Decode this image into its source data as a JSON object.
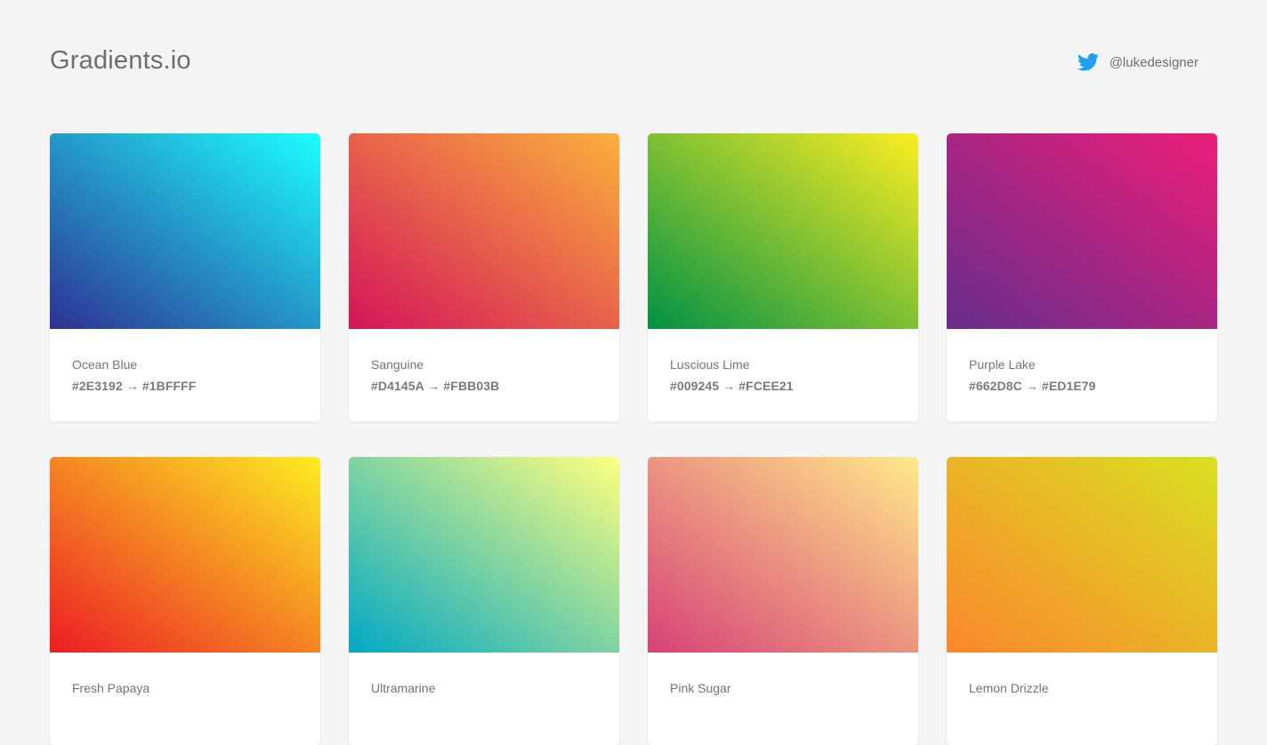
{
  "header": {
    "title": "Gradients.io",
    "twitter_icon": "twitter-bird-icon",
    "twitter_handle": "@lukedesigner",
    "twitter_color": "#1DA1F2"
  },
  "gradients": [
    {
      "name": "Ocean Blue",
      "from": "#2E3192",
      "to": "#1BFFFF",
      "codes": "#2E3192 → #1BFFFF"
    },
    {
      "name": "Sanguine",
      "from": "#D4145A",
      "to": "#FBB03B",
      "codes": "#D4145A → #FBB03B"
    },
    {
      "name": "Luscious Lime",
      "from": "#009245",
      "to": "#FCEE21",
      "codes": "#009245 → #FCEE21"
    },
    {
      "name": "Purple Lake",
      "from": "#662D8C",
      "to": "#ED1E79",
      "codes": "#662D8C → #ED1E79"
    },
    {
      "name": "Fresh Papaya",
      "from": "#ED1C24",
      "to": "#FCEE21",
      "codes": ""
    },
    {
      "name": "Ultramarine",
      "from": "#00A8C5",
      "to": "#FFFF7E",
      "codes": ""
    },
    {
      "name": "Pink Sugar",
      "from": "#D74177",
      "to": "#FFE98A",
      "codes": ""
    },
    {
      "name": "Lemon Drizzle",
      "from": "#FB872B",
      "to": "#D9E021",
      "codes": ""
    }
  ]
}
